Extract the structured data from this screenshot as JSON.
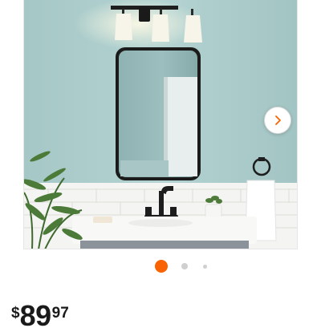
{
  "gallery": {
    "product_image_alt": "",
    "next_icon": "chevron-right-icon",
    "dots": [
      {
        "active": true
      },
      {
        "active": false
      },
      {
        "active": false
      }
    ],
    "accent_color": "#f96302"
  },
  "price": {
    "currency": "$",
    "dollars": "89",
    "cents": "97"
  }
}
